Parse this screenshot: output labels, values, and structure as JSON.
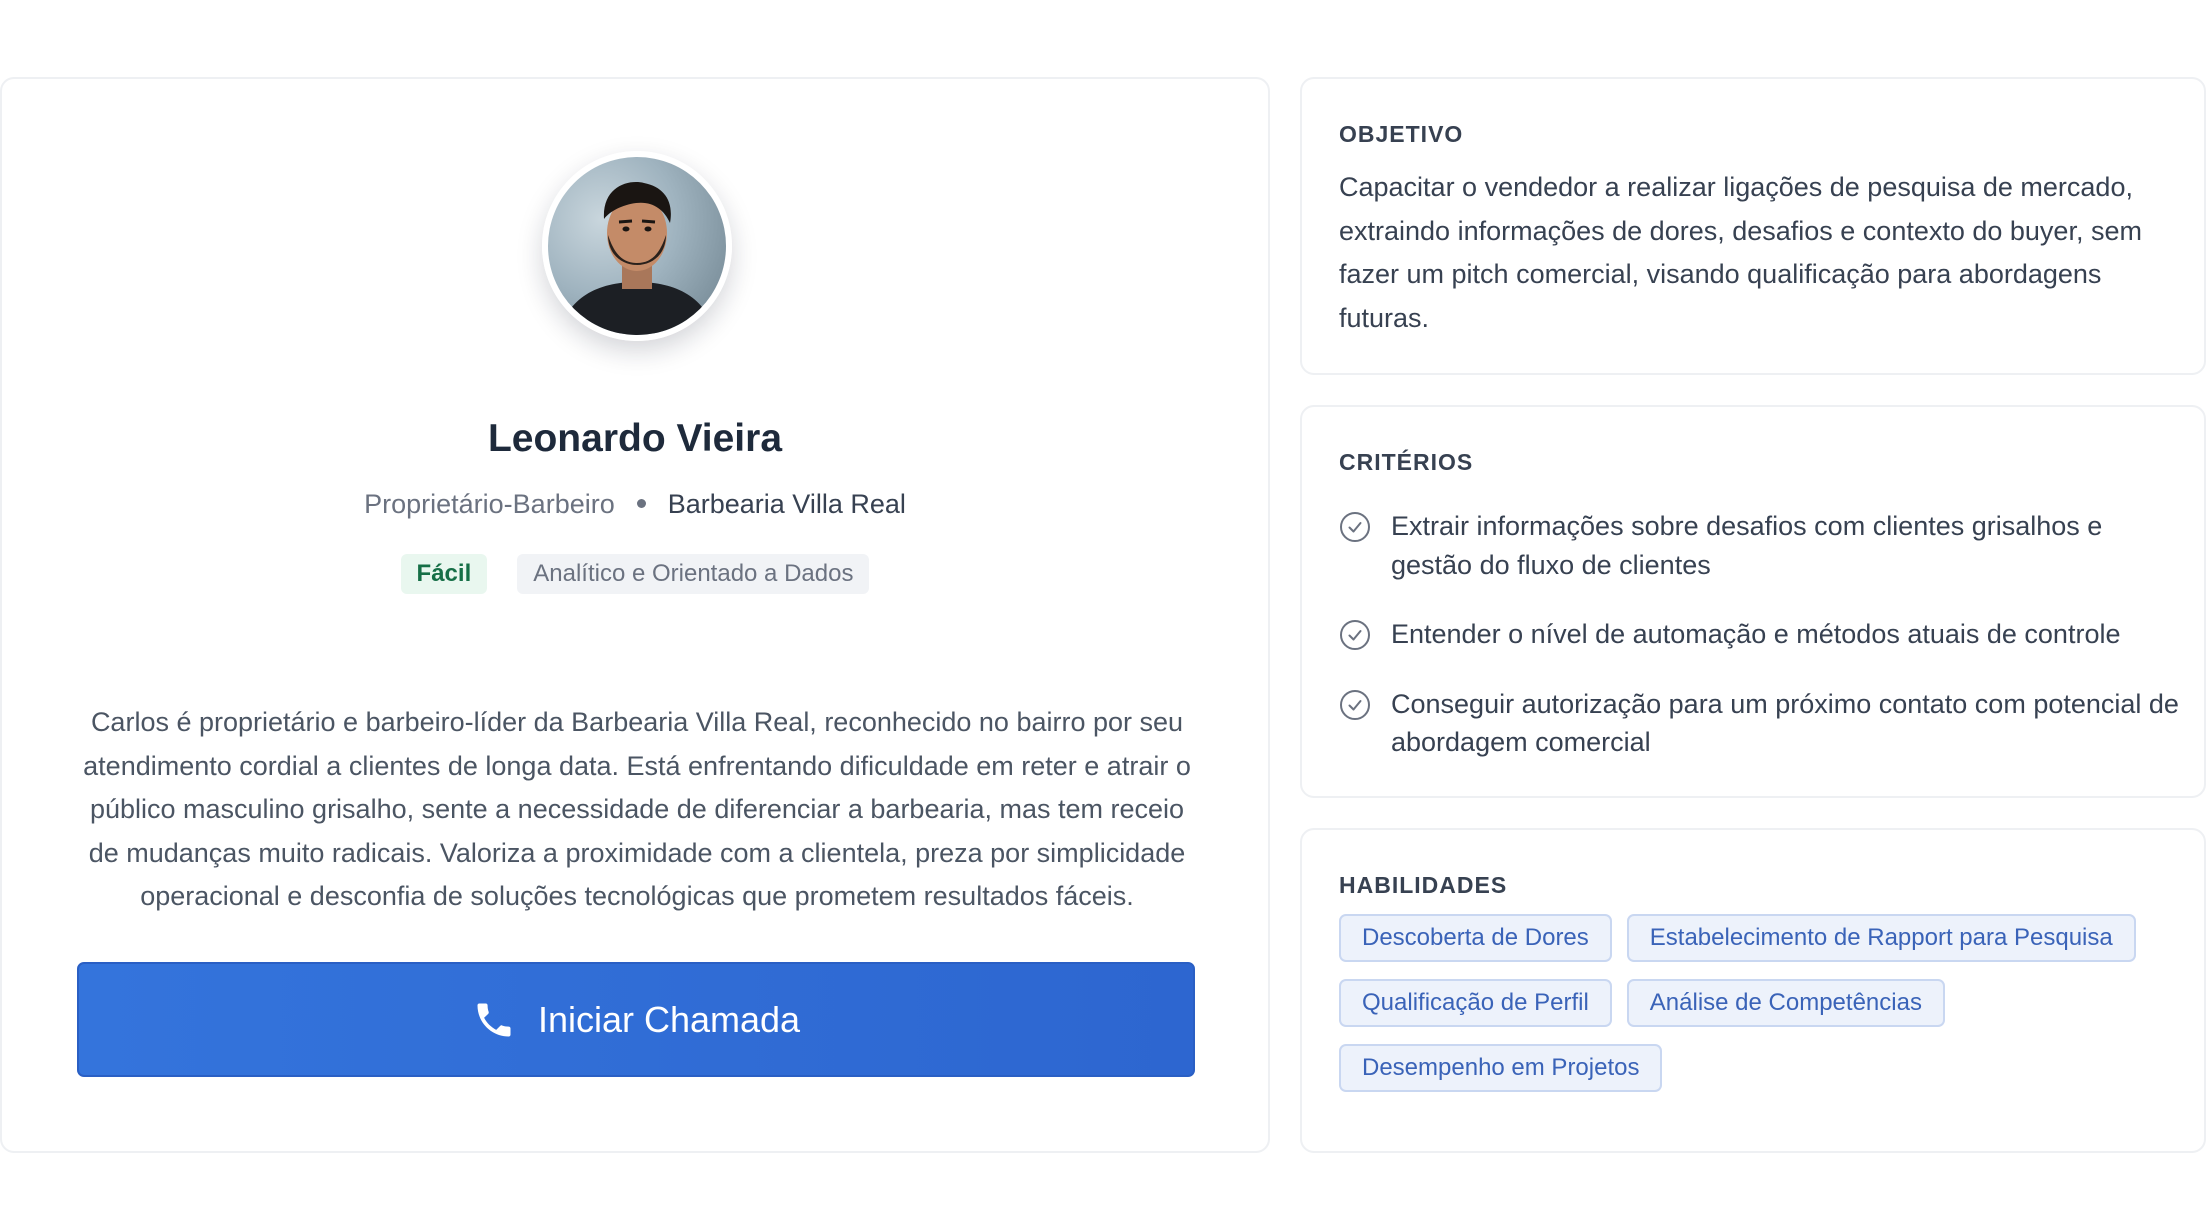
{
  "profile": {
    "name": "Leonardo Vieira",
    "role": "Proprietário-Barbeiro",
    "company": "Barbearia Villa Real",
    "difficulty": "Fácil",
    "style": "Analítico e Orientado a Dados",
    "bio": "Carlos é proprietário e barbeiro-líder da Barbearia Villa Real, reconhecido no bairro por seu atendimento cordial a clientes de longa data. Está enfrentando dificuldade em reter e atrair o público masculino grisalho, sente a necessidade de diferenciar a barbearia, mas tem receio de mudanças muito radicais. Valoriza a proximidade com a clientela, preza por simplicidade operacional e desconfia de soluções tecnológicas que prometem resultados fáceis.",
    "call_button": "Iniciar Chamada",
    "avatar_icon": "person-photo-avatar"
  },
  "objective": {
    "title": "OBJETIVO",
    "text": "Capacitar o vendedor a realizar ligações de pesquisa de mercado, extraindo informações de dores, desafios e contexto do buyer, sem fazer um pitch comercial, visando qualificação para abordagens futuras."
  },
  "criteria": {
    "title": "CRITÉRIOS",
    "items": [
      "Extrair informações sobre desafios com clientes grisalhos e gestão do fluxo de clientes",
      "Entender o nível de automação e métodos atuais de controle",
      "Conseguir autorização para um próximo contato com potencial de abordagem comercial"
    ]
  },
  "skills": {
    "title": "HABILIDADES",
    "items": [
      "Descoberta de Dores",
      "Estabelecimento de Rapport para Pesquisa",
      "Qualificação de Perfil",
      "Análise de Competências",
      "Desempenho em Projetos"
    ]
  },
  "colors": {
    "primary_button": "#3474dc",
    "easy_badge_text": "#166f47",
    "skill_text": "#3a63b8"
  }
}
